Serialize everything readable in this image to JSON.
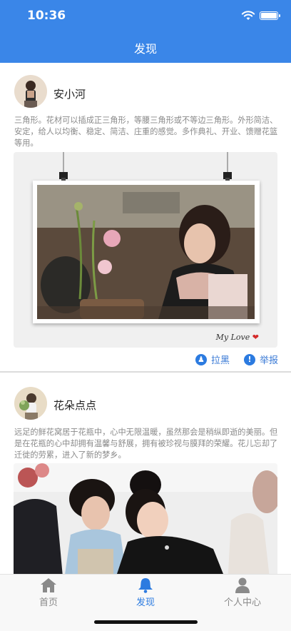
{
  "status_bar": {
    "time": "10:36",
    "icons": [
      "wifi-icon",
      "battery-icon"
    ]
  },
  "header": {
    "title": "发现",
    "color": "#3a86e8"
  },
  "posts": [
    {
      "username": "安小河",
      "text": "三角形。花材可以插成正三角形，等腰三角形或不等边三角形。外形简洁、安定，给人以均衡、稳定、简洁、庄重的感觉。多作典礼、开业、馈赠花篮等用。",
      "image_caption": "My Love",
      "actions": [
        {
          "label": "拉黑",
          "icon": "block-user-icon"
        },
        {
          "label": "举报",
          "icon": "report-icon"
        }
      ]
    },
    {
      "username": "花朵点点",
      "text": "远足的鲜花窝居于花瓶中，心中无限温暖，虽然那会是稍纵即逝的美丽。但是在花瓶的心中却拥有温馨与舒展，拥有被珍视与膜拜的荣耀。花儿忘却了迁徙的劳累，进入了新的梦乡。"
    }
  ],
  "tabbar": {
    "items": [
      {
        "label": "首页",
        "icon": "home-icon",
        "active": false
      },
      {
        "label": "发现",
        "icon": "bell-icon",
        "active": true
      },
      {
        "label": "个人中心",
        "icon": "user-icon",
        "active": false
      }
    ],
    "active_color": "#2c7be0",
    "inactive_color": "#8a8a8a"
  }
}
